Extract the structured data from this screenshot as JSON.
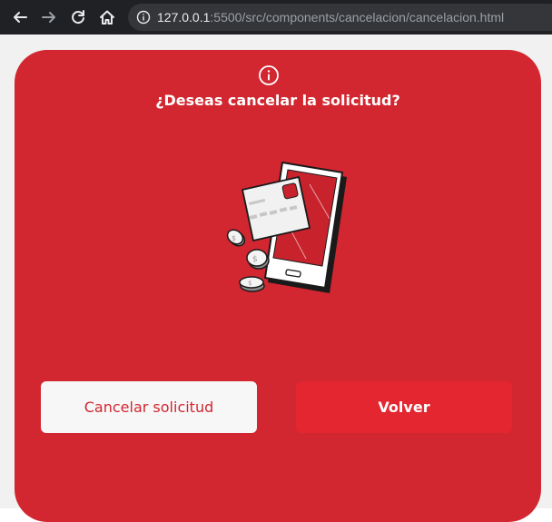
{
  "browser": {
    "url_host": "127.0.0.1",
    "url_rest": ":5500/src/components/cancelacion/cancelacion.html"
  },
  "dialog": {
    "title": "¿Deseas cancelar la solicitud?",
    "cancel_label": "Cancelar solicitud",
    "back_label": "Volver"
  },
  "colors": {
    "card_background": "#d22630",
    "back_button": "#e3262f",
    "cancel_button": "#f7f7f7",
    "cancel_text": "#d22630"
  },
  "icons": {
    "info": "info-icon",
    "illustration": "phone-card-coins-illustration"
  }
}
